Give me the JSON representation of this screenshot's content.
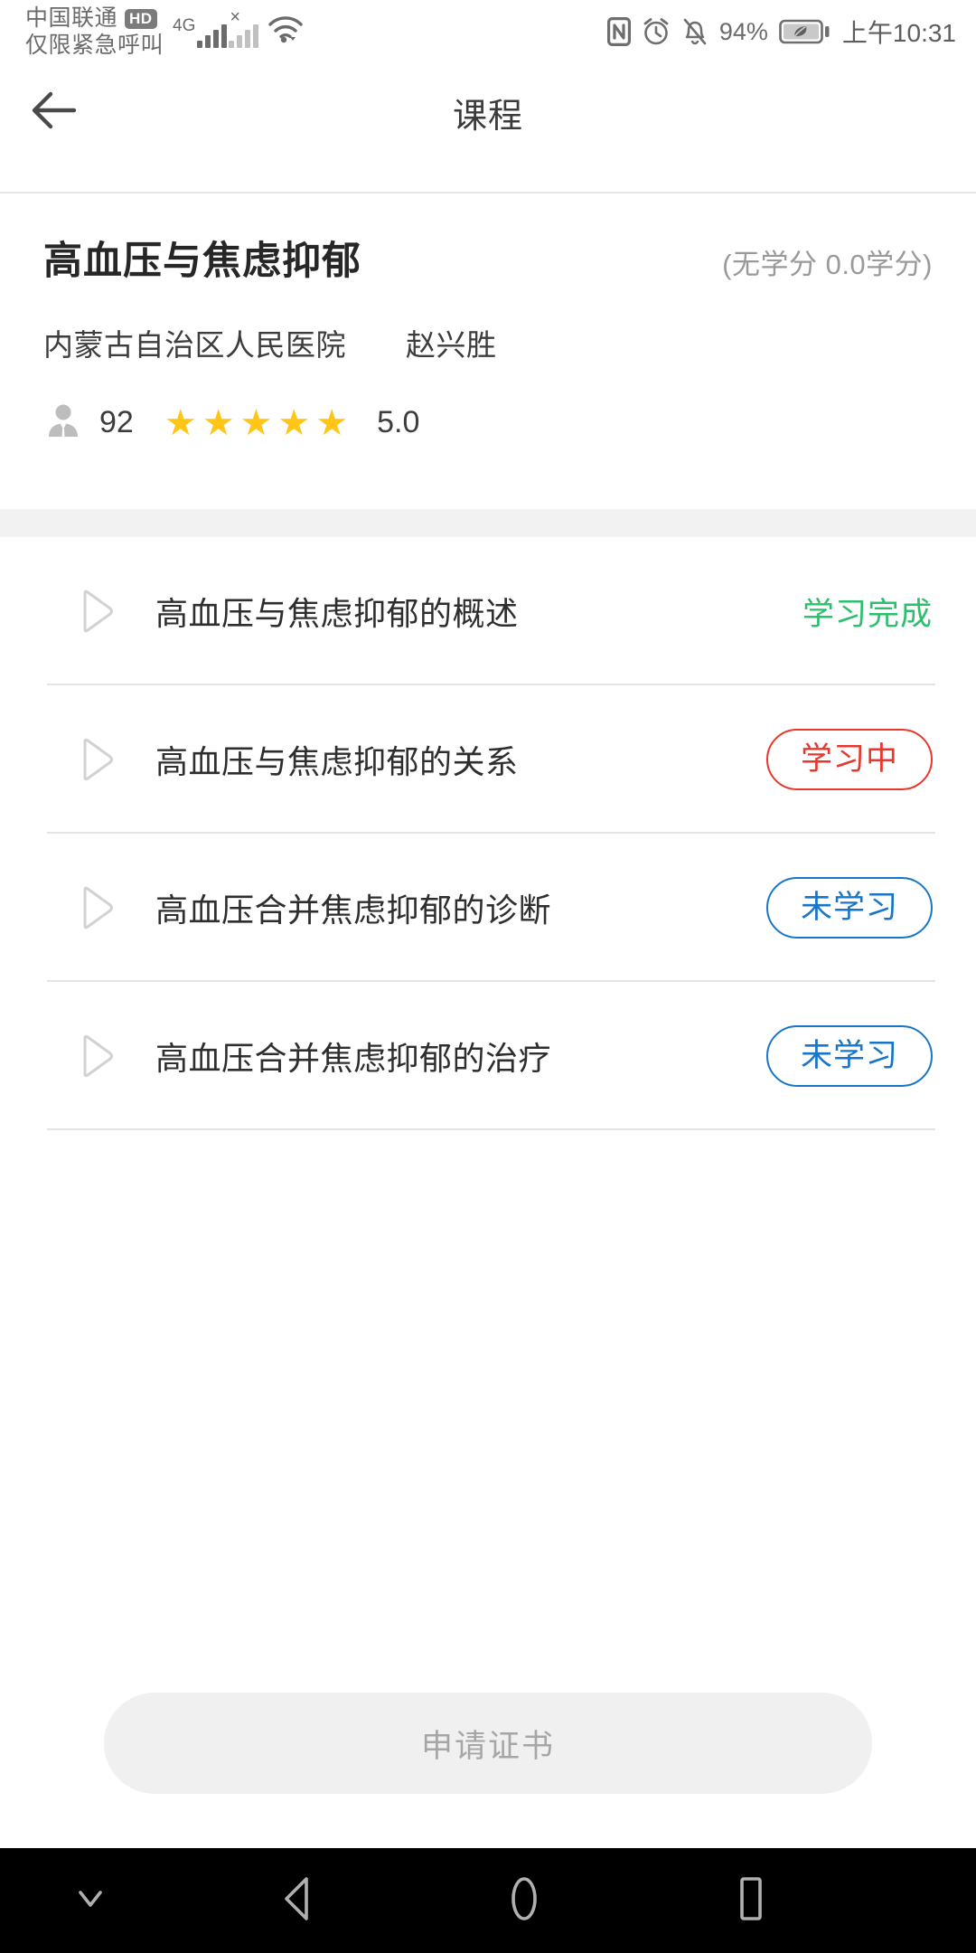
{
  "status_bar": {
    "carrier": "中国联通",
    "hd_badge": "HD",
    "emergency_text": "仅限紧急呼叫",
    "network_type": "4G",
    "battery_percent": "94%",
    "time": "上午10:31",
    "icons": [
      "signal-bars-icon",
      "signal-bars-no-service-icon",
      "wifi-icon",
      "nfc-icon",
      "alarm-icon",
      "mute-bell-icon",
      "battery-saver-icon"
    ]
  },
  "app_bar": {
    "back_icon": "arrow-left-icon",
    "title": "课程"
  },
  "course": {
    "title": "高血压与焦虑抑郁",
    "credits": "(无学分  0.0学分)",
    "organization": "内蒙古自治区人民医院",
    "teacher": "赵兴胜",
    "learner_icon": "person-icon",
    "learner_count": "92",
    "stars_filled": 5,
    "star_glyph": "★",
    "rating": "5.0"
  },
  "lessons": [
    {
      "play_icon": "play-outline-icon",
      "title": "高血压与焦虑抑郁的概述",
      "status": "学习完成",
      "style": "text",
      "color": "#2cbf6e"
    },
    {
      "play_icon": "play-outline-icon",
      "title": "高血压与焦虑抑郁的关系",
      "status": "学习中",
      "style": "pill",
      "color": "#e8372c"
    },
    {
      "play_icon": "play-outline-icon",
      "title": "高血压合并焦虑抑郁的诊断",
      "status": "未学习",
      "style": "pill",
      "color": "#1876c8"
    },
    {
      "play_icon": "play-outline-icon",
      "title": "高血压合并焦虑抑郁的治疗",
      "status": "未学习",
      "style": "pill",
      "color": "#1876c8"
    }
  ],
  "certificate_button": {
    "label": "申请证书",
    "enabled": false
  },
  "nav_bar": {
    "hide_keyboard_icon": "chevron-down-icon",
    "back_icon": "triangle-back-icon",
    "home_icon": "circle-home-icon",
    "recents_icon": "square-recents-icon"
  },
  "colors": {
    "accent_green": "#2cbf6e",
    "accent_red": "#e8372c",
    "accent_blue": "#1876c8",
    "star_gold": "#ffc517",
    "band_gray": "#f2f2f2"
  }
}
